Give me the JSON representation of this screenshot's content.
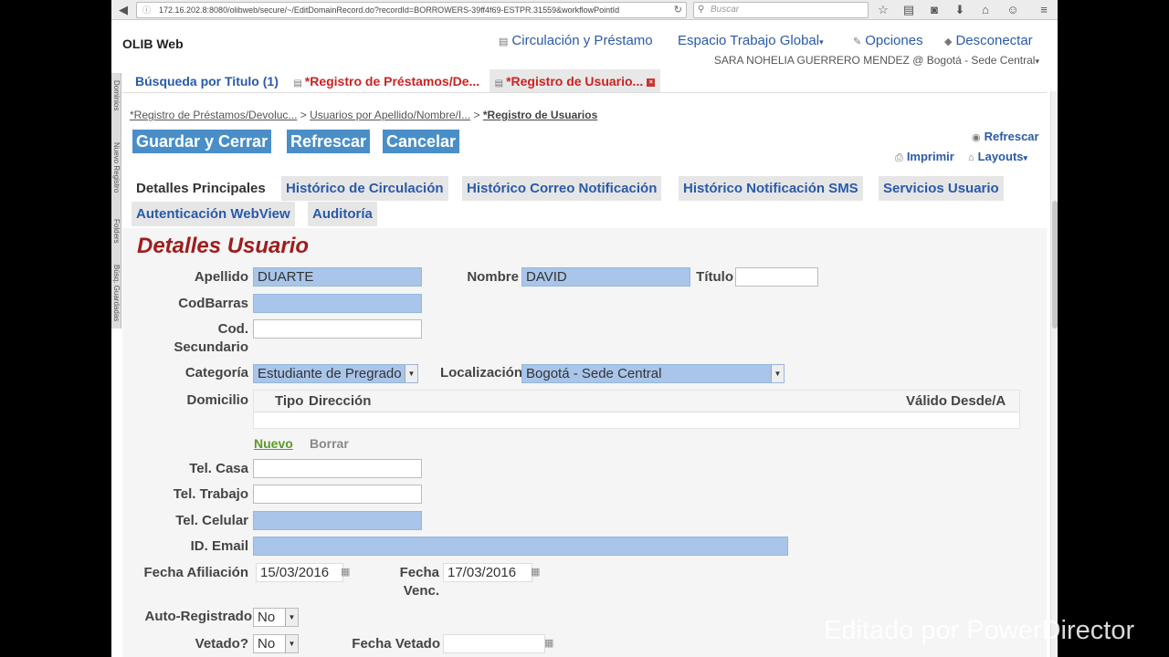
{
  "browser": {
    "url": "172.16.202.8:8080/olibweb/secure/~/EditDomainRecord.do?recordId=BORROWERS-39ff4f69-ESTPR.31559&workflowPointId",
    "search_placeholder": "Buscar"
  },
  "app": {
    "title": "OLIB Web",
    "nav": {
      "circulacion": "Circulación y Préstamo",
      "espacio": "Espacio Trabajo Global",
      "opciones": "Opciones",
      "desconectar": "Desconectar"
    },
    "user": "SARA NOHELIA GUERRERO MENDEZ @ Bogotá - Sede Central"
  },
  "side_strip": [
    "Dominios",
    "Nuevo Registro",
    "Folders",
    "Búsq. Guardadas"
  ],
  "doc_tabs": [
    "Búsqueda por Titulo (1)",
    "*Registro de Préstamos/De...",
    "*Registro de Usuario..."
  ],
  "breadcrumb": [
    "*Registro de Préstamos/Devoluc...",
    "Usuarios por Apellido/Nombre/I...",
    "*Registro de Usuarios"
  ],
  "actions": {
    "guardar": "Guardar y Cerrar",
    "refrescar": "Refrescar",
    "cancelar": "Cancelar",
    "refrescar_right": "Refrescar",
    "imprimir": "Imprimir",
    "layouts": "Layouts"
  },
  "section_tabs": [
    "Detalles Principales",
    "Histórico de Circulación",
    "Histórico Correo Notificación",
    "Histórico Notificación SMS",
    "Servicios Usuario",
    "Autenticación WebView",
    "Auditoría"
  ],
  "section_title": "Detalles Usuario",
  "form": {
    "apellido": {
      "label": "Apellido",
      "value": "DUARTE"
    },
    "nombre": {
      "label": "Nombre",
      "value": "DAVID"
    },
    "titulo": {
      "label": "Título",
      "value": ""
    },
    "codbarras": {
      "label": "CodBarras",
      "value": ""
    },
    "codsec": {
      "label1": "Cod.",
      "label2": "Secundario",
      "value": ""
    },
    "categoria": {
      "label": "Categoría",
      "value": "Estudiante de Pregrado"
    },
    "localizacion": {
      "label": "Localización",
      "value": "Bogotá - Sede Central"
    },
    "domicilio": {
      "label": "Domicilio",
      "col_tipo": "Tipo",
      "col_direccion": "Dirección",
      "col_valido": "Válido Desde/A"
    },
    "nuevo": "Nuevo",
    "borrar": "Borrar",
    "tel_casa": {
      "label": "Tel. Casa",
      "value": ""
    },
    "tel_trabajo": {
      "label": "Tel. Trabajo",
      "value": ""
    },
    "tel_celular": {
      "label": "Tel. Celular",
      "value": ""
    },
    "email": {
      "label": "ID. Email",
      "value": ""
    },
    "fecha_afiliacion": {
      "label": "Fecha Afiliación",
      "value": "15/03/2016"
    },
    "fecha_venc": {
      "label1": "Fecha",
      "label2": "Venc.",
      "value": "17/03/2016"
    },
    "auto_registrado": {
      "label": "Auto-Registrado",
      "value": "No"
    },
    "vetado": {
      "label": "Vetado?",
      "value": "No"
    },
    "fecha_vetado": {
      "label": "Fecha Vetado",
      "value": ""
    }
  },
  "watermark": "Editado por PowerDirector"
}
